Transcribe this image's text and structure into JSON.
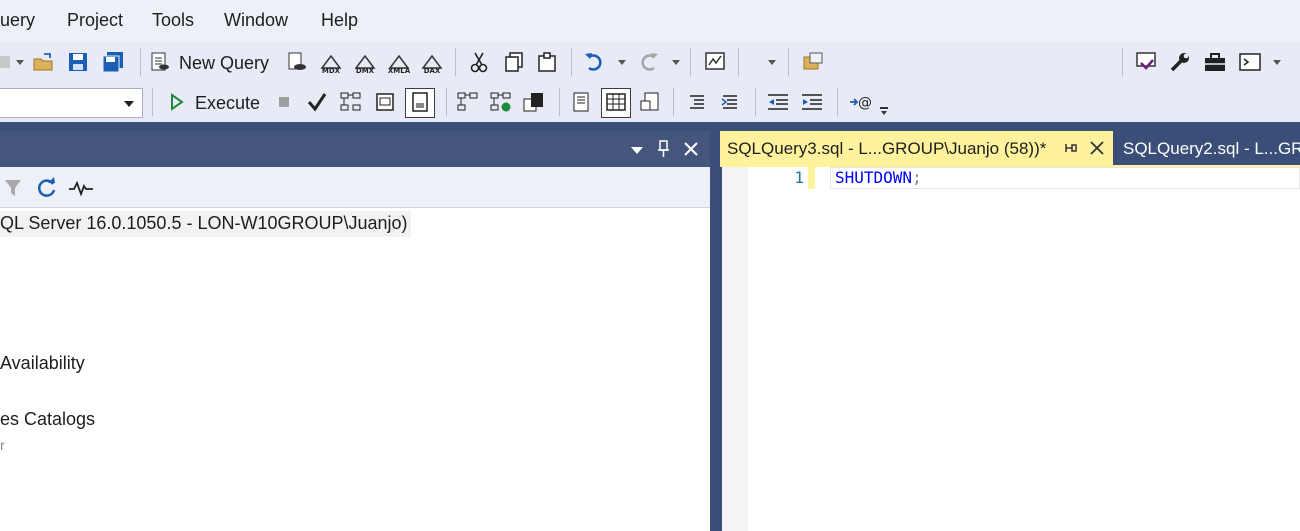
{
  "menu": {
    "items": [
      "uery",
      "Project",
      "Tools",
      "Window",
      "Help"
    ]
  },
  "toolbar1": {
    "new_query_label": "New Query",
    "mdx_label": "MDX",
    "dmx_label": "DMX",
    "xmla_label": "XMLA",
    "dax_label": "DAX",
    "search_combo_value": ""
  },
  "toolbar2": {
    "database_combo_value": "",
    "execute_label": "Execute"
  },
  "object_explorer": {
    "server_node": "QL Server 16.0.1050.5 - LON-W10GROUP\\Juanjo)",
    "node_availability": "Availability",
    "node_catalogs": "es Catalogs",
    "node_small": "r"
  },
  "tabs": {
    "active": "SQLQuery3.sql - L...GROUP\\Juanjo (58))*",
    "inactive": "SQLQuery2.sql - L...GR"
  },
  "editor": {
    "line_number": "1",
    "keyword": "SHUTDOWN",
    "punct": ";"
  },
  "colors": {
    "keyword": "#0000ff",
    "tab_active_bg": "#fff29d",
    "panel_title_bg": "#45567d"
  }
}
